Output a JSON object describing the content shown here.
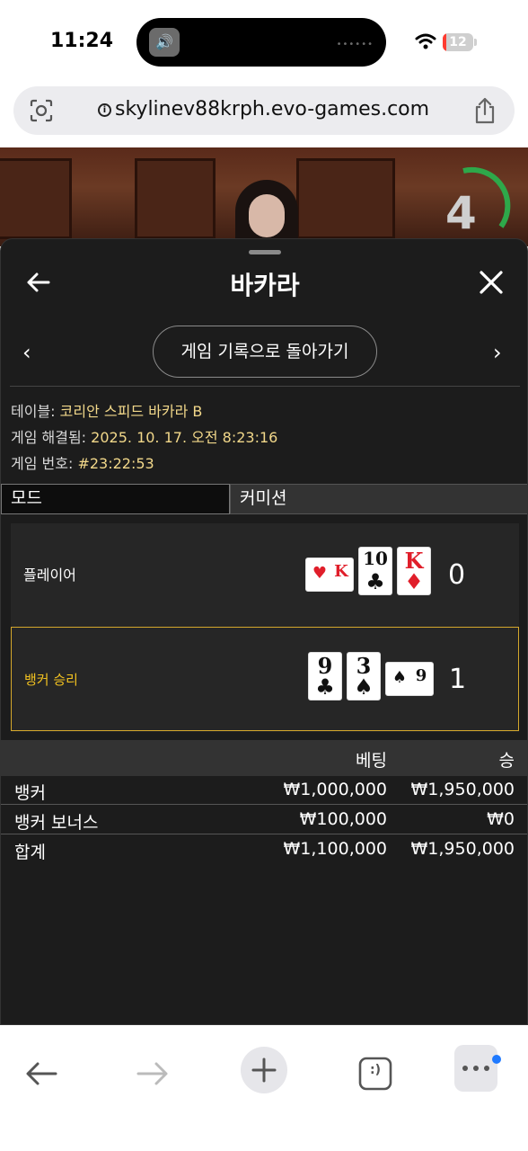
{
  "status": {
    "time": "11:24",
    "battery": "12",
    "battery_level": 0.12
  },
  "browser": {
    "url": "skylinev88krph.evo-games.com"
  },
  "video": {
    "countdown": "4"
  },
  "sheet": {
    "title": "바카라",
    "history_button": "게임 기록으로 돌아가기",
    "info": [
      {
        "label": "테이블:",
        "value": "코리안 스피드 바카라 B"
      },
      {
        "label": "게임 해결됨:",
        "value": "2025. 10. 17. 오전 8:23:16"
      },
      {
        "label": "게임 번호:",
        "value": "#23:22:53"
      }
    ],
    "tabs": {
      "mode": "모드",
      "commission": "커미션"
    },
    "result": {
      "player": {
        "label": "플레이어",
        "score": "0",
        "cards": [
          {
            "rank": "K",
            "suit": "♥",
            "color": "#e01e2a",
            "rotated": true
          },
          {
            "rank": "10",
            "suit": "♣",
            "color": "#111111",
            "rotated": false
          },
          {
            "rank": "K",
            "suit": "♦",
            "color": "#e01e2a",
            "rotated": false
          }
        ]
      },
      "banker": {
        "label": "뱅커 승리",
        "score": "1",
        "cards": [
          {
            "rank": "9",
            "suit": "♣",
            "color": "#111111",
            "rotated": false
          },
          {
            "rank": "3",
            "suit": "♠",
            "color": "#111111",
            "rotated": false
          },
          {
            "rank": "9",
            "suit": "♠",
            "color": "#111111",
            "rotated": true
          }
        ]
      }
    },
    "bets": {
      "header": {
        "bet": "베팅",
        "win": "승"
      },
      "rows": [
        {
          "name": "뱅커",
          "bet": "₩1,000,000",
          "win": "₩1,950,000"
        },
        {
          "name": "뱅커 보너스",
          "bet": "₩100,000",
          "win": "₩0"
        },
        {
          "name": "합계",
          "bet": "₩1,100,000",
          "win": "₩1,950,000"
        }
      ]
    }
  },
  "toolbar": {
    "tabs_label": ":)"
  }
}
